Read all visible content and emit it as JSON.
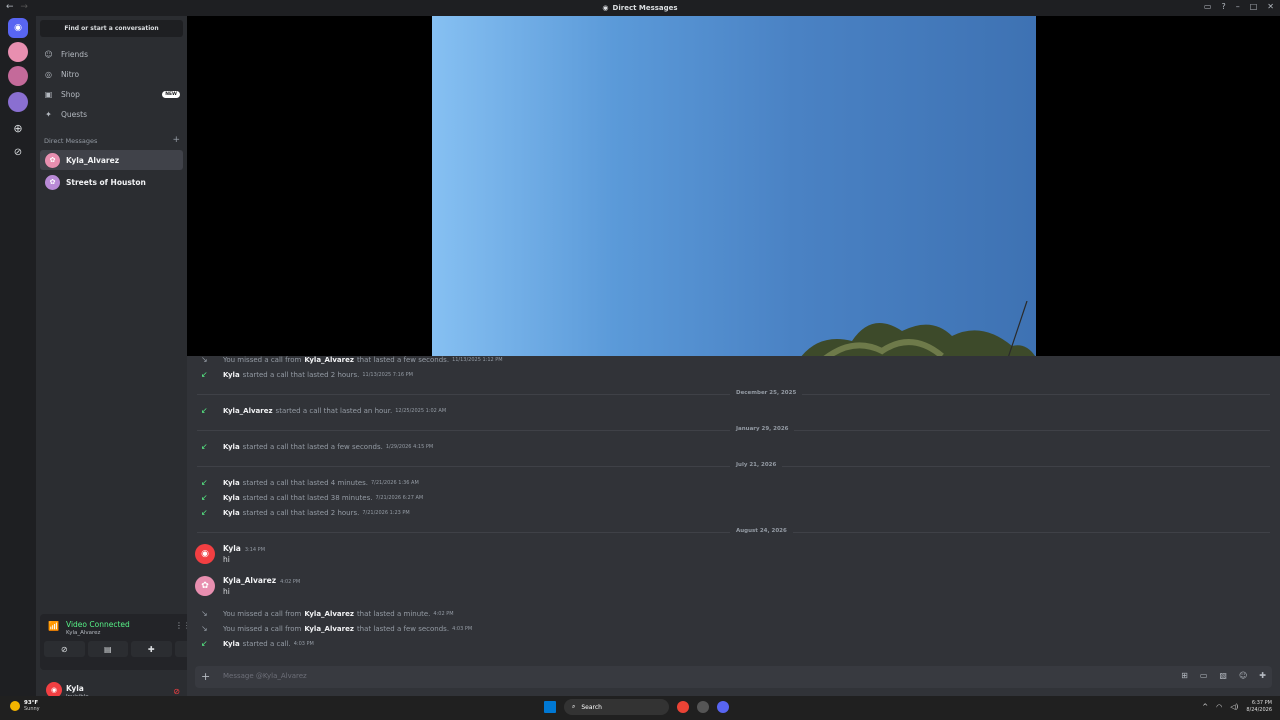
{
  "titlebar": {
    "title": "Direct Messages",
    "nav_back": "←",
    "nav_forward": "→"
  },
  "sidebar": {
    "find_label": "Find or start a conversation",
    "nav": [
      {
        "label": "Friends",
        "icon": "friends-icon"
      },
      {
        "label": "Nitro",
        "icon": "nitro-icon"
      },
      {
        "label": "Shop",
        "icon": "shop-icon",
        "badge": "NEW"
      },
      {
        "label": "Quests",
        "icon": "quests-icon"
      }
    ],
    "dm_header": "Direct Messages",
    "dms": [
      {
        "name": "Kyla_Alvarez"
      },
      {
        "name": "Streets of Houston"
      }
    ]
  },
  "voice": {
    "status": "Video Connected",
    "channel": "Kyla_Alvarez"
  },
  "user": {
    "name": "Kyla",
    "status": "Invisible"
  },
  "messages": {
    "calls": [
      {
        "who": "",
        "pre": "You missed a call from",
        "bold": "Kyla_Alvarez",
        "post": "that lasted a few seconds.",
        "ts": "11/13/2025 1:12 PM",
        "missed": true
      },
      {
        "who": "Kyla",
        "pre": "",
        "bold": "",
        "post": "started a call that lasted 2 hours.",
        "ts": "11/13/2025 7:16 PM",
        "missed": false
      },
      {
        "who": "Kyla_Alvarez",
        "pre": "",
        "bold": "",
        "post": "started a call that lasted an hour.",
        "ts": "12/25/2025 1:02 AM",
        "missed": false
      },
      {
        "who": "Kyla",
        "pre": "",
        "bold": "",
        "post": "started a call that lasted a few seconds.",
        "ts": "1/29/2026 4:15 PM",
        "missed": false
      },
      {
        "who": "Kyla",
        "pre": "",
        "bold": "",
        "post": "started a call that lasted 4 minutes.",
        "ts": "7/21/2026 1:36 AM",
        "missed": false
      },
      {
        "who": "Kyla",
        "pre": "",
        "bold": "",
        "post": "started a call that lasted 38 minutes.",
        "ts": "7/21/2026 6:27 AM",
        "missed": false
      },
      {
        "who": "Kyla",
        "pre": "",
        "bold": "",
        "post": "started a call that lasted 2 hours.",
        "ts": "7/21/2026 1:23 PM",
        "missed": false
      },
      {
        "who": "",
        "pre": "You missed a call from",
        "bold": "Kyla_Alvarez",
        "post": "that lasted a minute.",
        "ts": "4:02 PM",
        "missed": true
      },
      {
        "who": "",
        "pre": "You missed a call from",
        "bold": "Kyla_Alvarez",
        "post": "that lasted a few seconds.",
        "ts": "4:03 PM",
        "missed": true
      },
      {
        "who": "Kyla",
        "pre": "",
        "bold": "",
        "post": "started a call.",
        "ts": "4:03 PM",
        "missed": false
      }
    ],
    "dividers": [
      "December 25, 2025",
      "January 29, 2026",
      "July 21, 2026",
      "August 24, 2026"
    ],
    "chat": [
      {
        "author": "Kyla",
        "ts": "3:14 PM",
        "text": "hi"
      },
      {
        "author": "Kyla_Alvarez",
        "ts": "4:02 PM",
        "text": "hi"
      }
    ]
  },
  "composer": {
    "placeholder": "Message @Kyla_Alvarez"
  },
  "taskbar": {
    "temp": "93°F",
    "condition": "Sunny",
    "search_label": "Search",
    "time": "6:37 PM",
    "date": "8/24/2026"
  }
}
